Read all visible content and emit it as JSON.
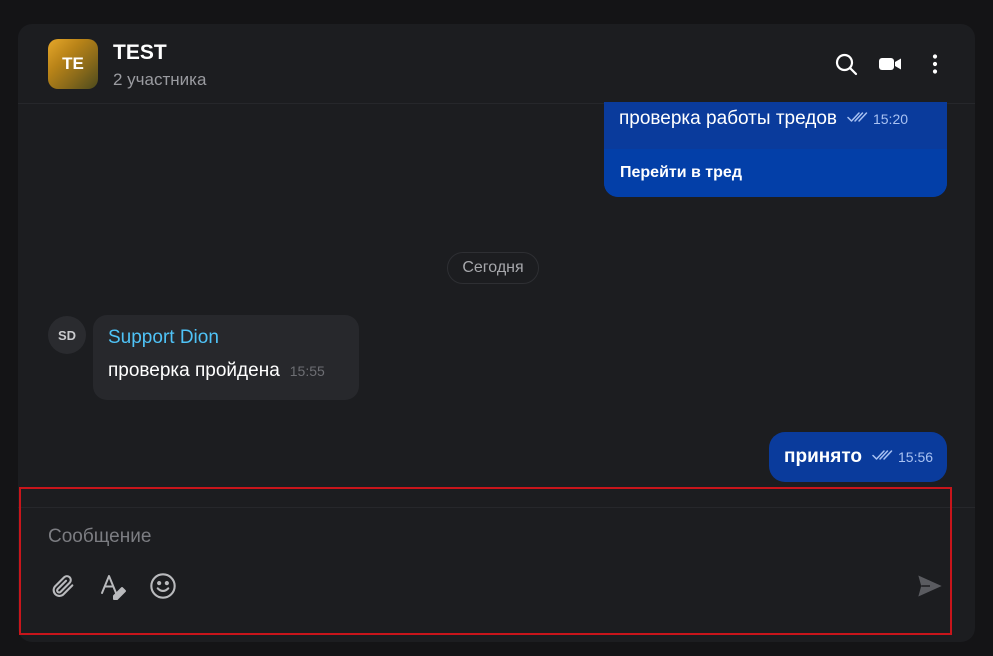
{
  "header": {
    "avatar_initials": "TE",
    "title": "TEST",
    "subtitle": "2 участника",
    "actions": [
      "search-icon",
      "video-call-icon",
      "more-vertical-icon"
    ]
  },
  "messages": {
    "thread_message": {
      "text": "проверка работы тредов",
      "time": "15:20",
      "status": "read",
      "thread_link": "Перейти в тред"
    },
    "day_separator": "Сегодня",
    "incoming": {
      "avatar_initials": "SD",
      "sender": "Support Dion",
      "text": "проверка пройдена",
      "time": "15:55"
    },
    "last_outgoing": {
      "text": "принято",
      "time": "15:56",
      "status": "read"
    }
  },
  "composer": {
    "placeholder": "Сообщение",
    "value": "",
    "tools": [
      "attach-icon",
      "text-format-icon",
      "emoji-icon"
    ],
    "send_icon": "send-icon"
  },
  "colors": {
    "outgoing_bubble": "#0a3b9c",
    "sender_name": "#4fc3f7",
    "highlight_border": "#c8151b"
  }
}
